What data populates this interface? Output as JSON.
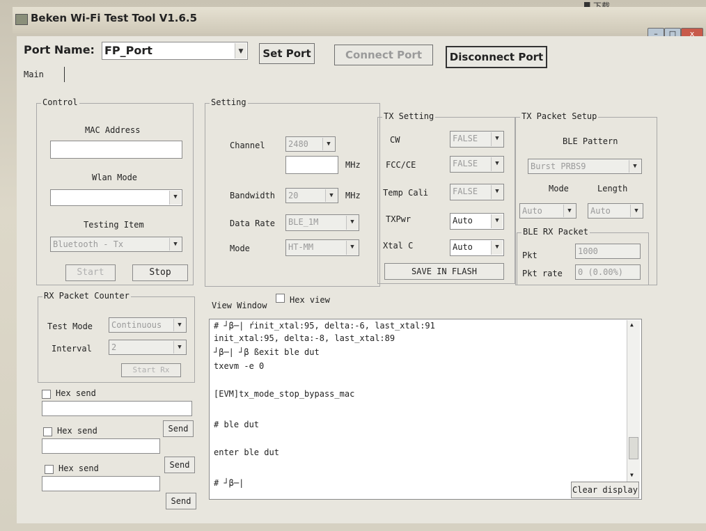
{
  "window": {
    "title": "Beken Wi-Fi Test Tool V1.6.5",
    "close_label": "x"
  },
  "desktop": {
    "download_label": "下载"
  },
  "port": {
    "label": "Port Name:",
    "value": "FP_Port",
    "set_button": "Set Port",
    "connect_button": "Connect Port",
    "disconnect_button": "Disconnect Port"
  },
  "tabs": [
    "Main"
  ],
  "control": {
    "title": "Control",
    "mac_label": "MAC Address",
    "mac_value": "",
    "wlan_label": "Wlan Mode",
    "wlan_value": "",
    "testing_label": "Testing Item",
    "testing_value": "Bluetooth - Tx",
    "start_button": "Start",
    "stop_button": "Stop"
  },
  "setting": {
    "title": "Setting",
    "channel_label": "Channel",
    "channel_value": "2480",
    "channel_mhz": "",
    "mhz": "MHz",
    "bandwidth_label": "Bandwidth",
    "bandwidth_value": "20",
    "datarate_label": "Data Rate",
    "datarate_value": "BLE_1M",
    "mode_label": "Mode",
    "mode_value": "HT-MM"
  },
  "tx_setting": {
    "title": "TX Setting",
    "cw_label": "CW",
    "cw_value": "FALSE",
    "fcc_label": "FCC/CE",
    "fcc_value": "FALSE",
    "temp_label": "Temp Cali",
    "temp_value": "FALSE",
    "txpwr_label": "TXPwr",
    "txpwr_value": "Auto",
    "xtal_label": "Xtal C",
    "xtal_value": "Auto",
    "save_button": "SAVE IN FLASH"
  },
  "tx_packet": {
    "title": "TX Packet Setup",
    "ble_pattern_label": "BLE Pattern",
    "ble_pattern_value": "Burst PRBS9",
    "mode_label": "Mode",
    "length_label": "Length",
    "mode_value": "Auto",
    "length_value": "Auto"
  },
  "ble_rx": {
    "title": "BLE RX Packet",
    "pkt_label": "Pkt",
    "pkt_value": "1000",
    "rate_label": "Pkt rate",
    "rate_value": "0 (0.00%)"
  },
  "rx_counter": {
    "title": "RX Packet Counter",
    "test_mode_label": "Test Mode",
    "test_mode_value": "Continuous",
    "interval_label": "Interval",
    "interval_value": "2",
    "start_button": "Start Rx"
  },
  "hex_send": [
    {
      "label": "Hex send",
      "value": "",
      "button": ""
    },
    {
      "label": "Hex send",
      "value": "",
      "button": "Send"
    },
    {
      "label": "Hex send",
      "value": "",
      "button": "Send"
    },
    {
      "label": "",
      "value": "",
      "button": "Send"
    }
  ],
  "view_window": {
    "title": "View Window",
    "hex_view_label": "Hex view",
    "lines": [
      "# ┘β─| ŕinit_xtal:95, delta:-6, last_xtal:91",
      "init_xtal:95, delta:-8, last_xtal:89",
      "┘β─| ┘β ßexit ble dut",
      "txevm -e 0",
      "",
      "[EVM]tx_mode_stop_bypass_mac",
      "",
      "# ble dut",
      "",
      "enter ble dut",
      "",
      "# ┘β─|"
    ],
    "clear_button": "Clear display"
  }
}
